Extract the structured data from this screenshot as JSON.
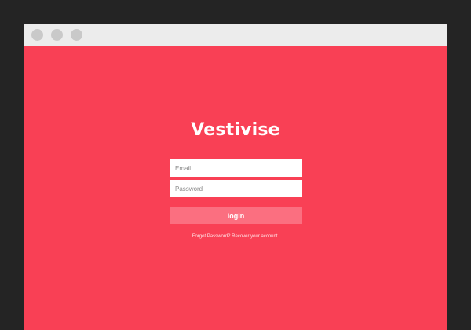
{
  "window": {
    "controls": [
      "close",
      "minimize",
      "maximize"
    ]
  },
  "brand": {
    "name": "Vestivise"
  },
  "form": {
    "email_placeholder": "Email",
    "password_placeholder": "Password",
    "login_label": "login",
    "forgot_text": "Forgot Password? Recover your account."
  },
  "colors": {
    "background": "#f94055",
    "login_button": "#fb6f80",
    "titlebar": "#ececec",
    "frame": "#242424"
  }
}
